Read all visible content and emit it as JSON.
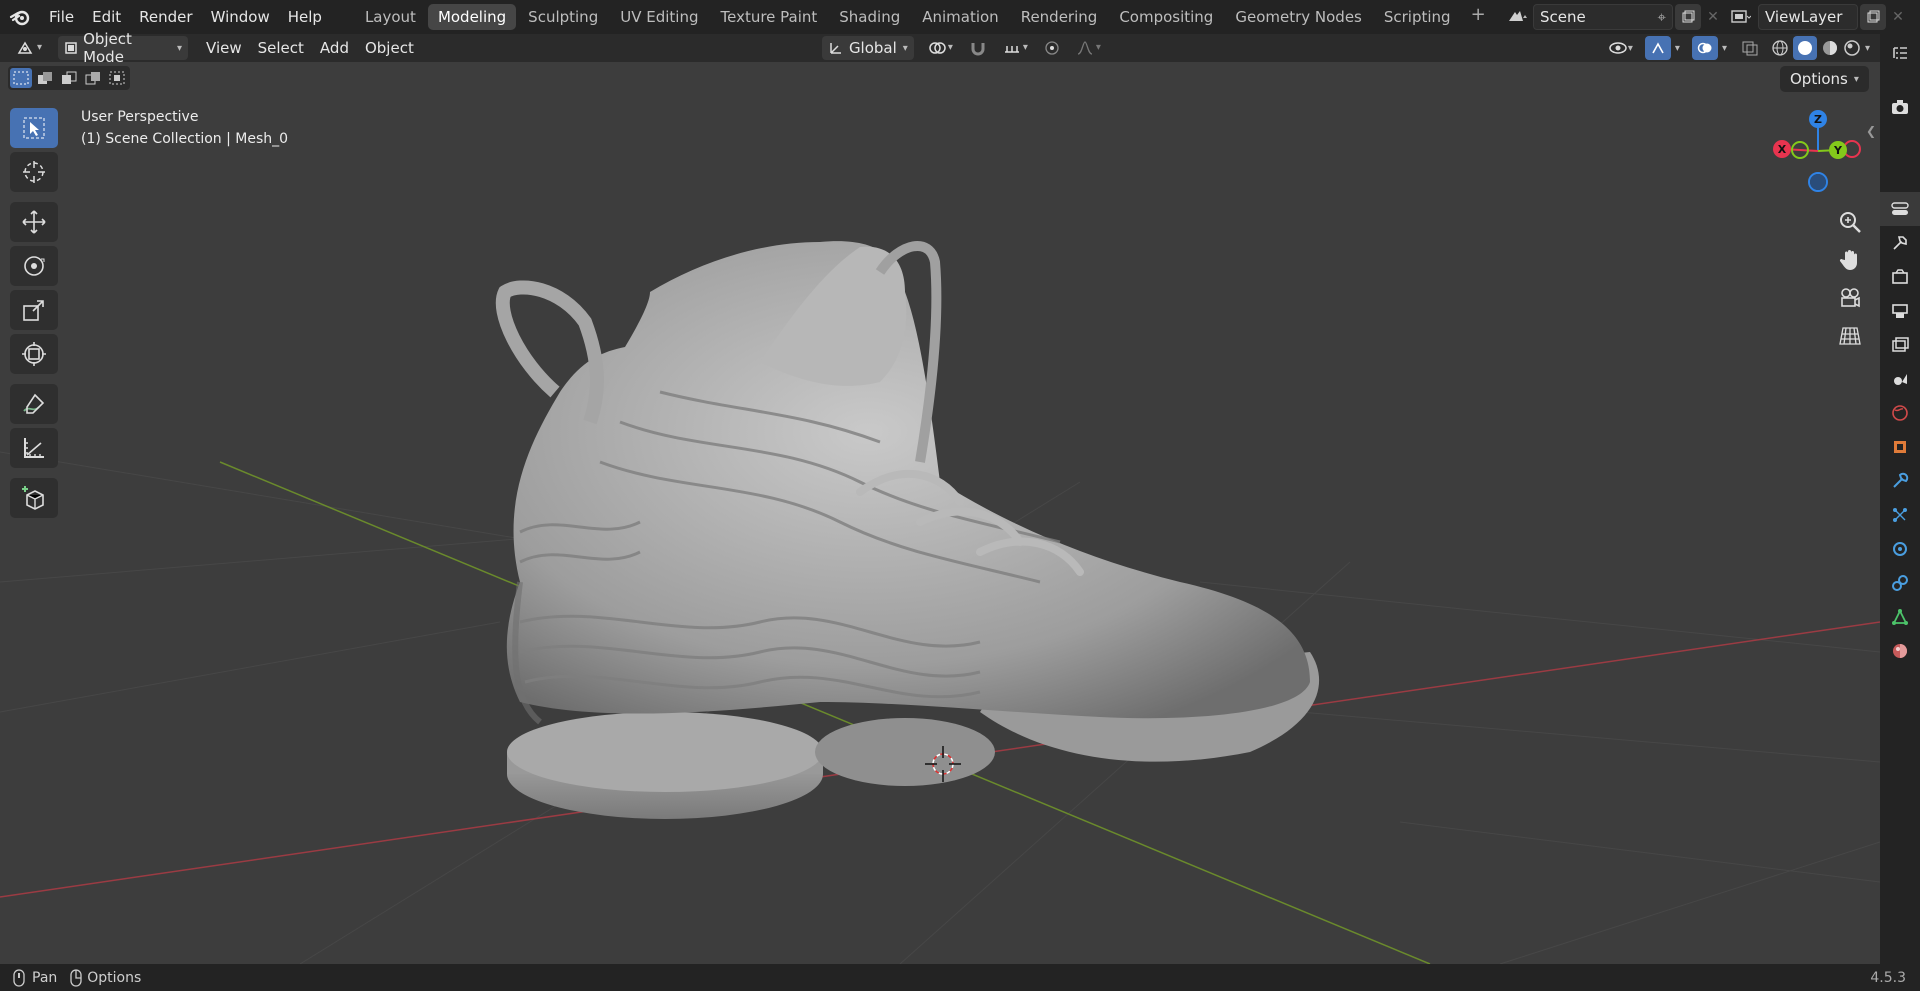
{
  "menu": {
    "file": "File",
    "edit": "Edit",
    "render": "Render",
    "window": "Window",
    "help": "Help"
  },
  "workspaces": [
    "Layout",
    "Modeling",
    "Sculpting",
    "UV Editing",
    "Texture Paint",
    "Shading",
    "Animation",
    "Rendering",
    "Compositing",
    "Geometry Nodes",
    "Scripting"
  ],
  "active_workspace": "Modeling",
  "scene": {
    "name": "Scene"
  },
  "view_layer": {
    "name": "ViewLayer"
  },
  "header": {
    "mode": "Object Mode",
    "view": "View",
    "select": "Select",
    "add": "Add",
    "object": "Object",
    "orientation": "Global"
  },
  "viewport": {
    "perspective": "User Perspective",
    "collection_info": "(1) Scene Collection | Mesh_0",
    "options": "Options"
  },
  "gizmo": {
    "x": "X",
    "y": "Y",
    "z": "Z"
  },
  "statusbar": {
    "pan": "Pan",
    "options": "Options",
    "version": "4.5.3"
  },
  "colors": {
    "accent": "#4772b3",
    "x_axis": "#e8344f",
    "y_axis": "#84c91b",
    "z_axis": "#2f83e6"
  }
}
